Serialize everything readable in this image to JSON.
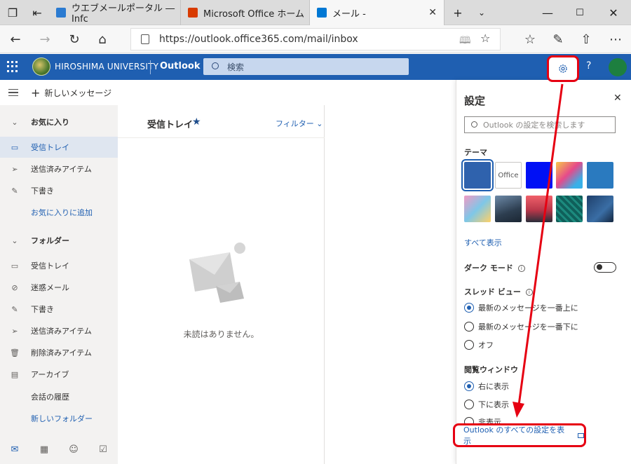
{
  "browser": {
    "tabs": [
      {
        "title": "ウエブメールポータル ― Infc",
        "favicon_color": "#2b7bd1"
      },
      {
        "title": "Microsoft Office ホーム",
        "favicon_color": "#d83b01"
      },
      {
        "title": "メール -",
        "favicon_color": "#0078d4"
      }
    ],
    "url": "https://outlook.office365.com/mail/inbox"
  },
  "header": {
    "university": "HIROSHIMA UNIVERSITY",
    "app_name": "Outlook",
    "search_placeholder": "検索",
    "help": "?"
  },
  "command": {
    "new_message": "新しいメッセージ"
  },
  "favorites": {
    "heading": "お気に入り",
    "items": [
      {
        "label": "受信トレイ",
        "icon": "inbox-icon",
        "selected": true
      },
      {
        "label": "送信済みアイテム",
        "icon": "send-icon"
      },
      {
        "label": "下書き",
        "icon": "pencil-icon"
      },
      {
        "label": "お気に入りに追加",
        "link": true
      }
    ]
  },
  "folders": {
    "heading": "フォルダー",
    "items": [
      {
        "label": "受信トレイ",
        "icon": "inbox-icon"
      },
      {
        "label": "迷惑メール",
        "icon": "blocked-icon"
      },
      {
        "label": "下書き",
        "icon": "pencil-icon"
      },
      {
        "label": "送信済みアイテム",
        "icon": "send-icon"
      },
      {
        "label": "削除済みアイテム",
        "icon": "trash-icon"
      },
      {
        "label": "アーカイブ",
        "icon": "archive-icon"
      },
      {
        "label": "会話の履歴"
      },
      {
        "label": "新しいフォルダー",
        "link": true
      }
    ]
  },
  "message_list": {
    "title": "受信トレイ",
    "filter": "フィルター",
    "empty_text": "未読はありません。"
  },
  "settings": {
    "title": "設定",
    "search_placeholder": "Outlook の設定を検索します",
    "theme_label": "テーマ",
    "office_theme_text": "Office",
    "show_all": "すべて表示",
    "dark_mode": "ダーク モード",
    "dark_mode_on": false,
    "thread_view_label": "スレッド ビュー",
    "thread_options": [
      "最新のメッセージを一番上に",
      "最新のメッセージを一番下に",
      "オフ"
    ],
    "thread_selected": 0,
    "reading_pane_label": "閲覧ウィンドウ",
    "reading_options": [
      "右に表示",
      "下に表示",
      "非表示"
    ],
    "reading_selected": 0,
    "view_all_settings": "Outlook のすべての設定を表示"
  },
  "colors": {
    "outlook_blue": "#1f5fb1",
    "highlight_red": "#e60012"
  }
}
